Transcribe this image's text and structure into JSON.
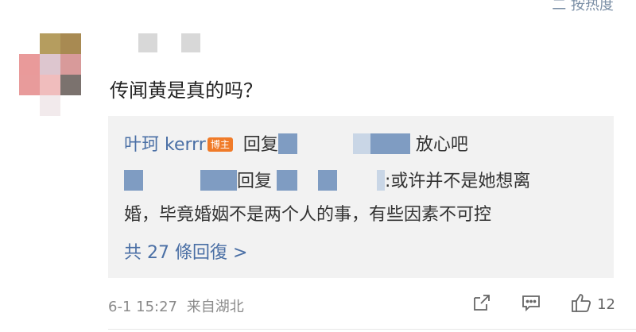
{
  "header": {
    "sort_label": "二 按热度"
  },
  "comment": {
    "text": "传闻黄是真的吗？",
    "replies": [
      {
        "author": "叶珂 kerrr",
        "badge": "博主",
        "verb": "回复",
        "text": "放心吧"
      },
      {
        "verb": "回复",
        "text_line1": ":或许并不是她想离",
        "text_line2": "婚，毕竟婚姻不是两个人的事，有些因素不可控"
      }
    ],
    "more_replies": "共 27 條回復 >",
    "timestamp": "6-1 15:27",
    "location": "来自湖北",
    "likes": "12"
  },
  "colors": {
    "link": "#4a6fa5",
    "badge": "#f07b29",
    "reply_bg": "#f2f2f2"
  },
  "icons": [
    "share-icon",
    "comment-icon",
    "like-icon"
  ]
}
